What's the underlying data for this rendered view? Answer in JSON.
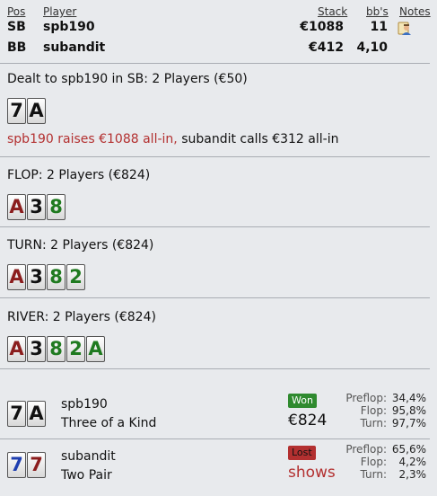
{
  "header": {
    "pos_label": "Pos",
    "player_label": "Player",
    "stack_label": "Stack",
    "bb_label": "bb's",
    "notes_label": "Notes"
  },
  "players": [
    {
      "pos": "SB",
      "name": "spb190",
      "stack": "€1088",
      "bb": "11",
      "has_note": true
    },
    {
      "pos": "BB",
      "name": "subandit",
      "stack": "€412",
      "bb": "4,10",
      "has_note": false
    }
  ],
  "preflop": {
    "title": "Dealt to spb190 in SB: 2 Players (€50)",
    "cards": [
      {
        "rank": "7",
        "color": "black"
      },
      {
        "rank": "A",
        "color": "black"
      }
    ],
    "action_raise": "spb190 raises €1088 all-in,",
    "action_call": "subandit calls €312 all-in"
  },
  "flop": {
    "title": "FLOP: 2 Players (€824)",
    "cards": [
      {
        "rank": "A",
        "color": "red"
      },
      {
        "rank": "3",
        "color": "black"
      },
      {
        "rank": "8",
        "color": "green"
      }
    ]
  },
  "turn": {
    "title": "TURN: 2 Players (€824)",
    "cards": [
      {
        "rank": "A",
        "color": "red"
      },
      {
        "rank": "3",
        "color": "black"
      },
      {
        "rank": "8",
        "color": "green"
      },
      {
        "rank": "2",
        "color": "green"
      }
    ]
  },
  "river": {
    "title": "RIVER: 2 Players (€824)",
    "cards": [
      {
        "rank": "A",
        "color": "red"
      },
      {
        "rank": "3",
        "color": "black"
      },
      {
        "rank": "8",
        "color": "green"
      },
      {
        "rank": "2",
        "color": "green"
      },
      {
        "rank": "A",
        "color": "green"
      }
    ]
  },
  "results": [
    {
      "name": "spb190",
      "hand": "Three of a Kind",
      "cards": [
        {
          "rank": "7",
          "color": "black"
        },
        {
          "rank": "A",
          "color": "black"
        }
      ],
      "badge": "Won",
      "outcome": "€824",
      "equity": {
        "preflop_label": "Preflop:",
        "preflop": "34,4%",
        "flop_label": "Flop:",
        "flop": "95,8%",
        "turn_label": "Turn:",
        "turn": "97,7%"
      }
    },
    {
      "name": "subandit",
      "hand": "Two Pair",
      "cards": [
        {
          "rank": "7",
          "color": "blue"
        },
        {
          "rank": "7",
          "color": "red"
        }
      ],
      "badge": "Lost",
      "outcome": "shows",
      "equity": {
        "preflop_label": "Preflop:",
        "preflop": "65,6%",
        "flop_label": "Flop:",
        "flop": "4,2%",
        "turn_label": "Turn:",
        "turn": "2,3%"
      }
    }
  ],
  "colors": {
    "background": "#e8eaed",
    "action_red": "#b33030",
    "won_green": "#2f8a2f",
    "lost_red": "#b33030"
  }
}
